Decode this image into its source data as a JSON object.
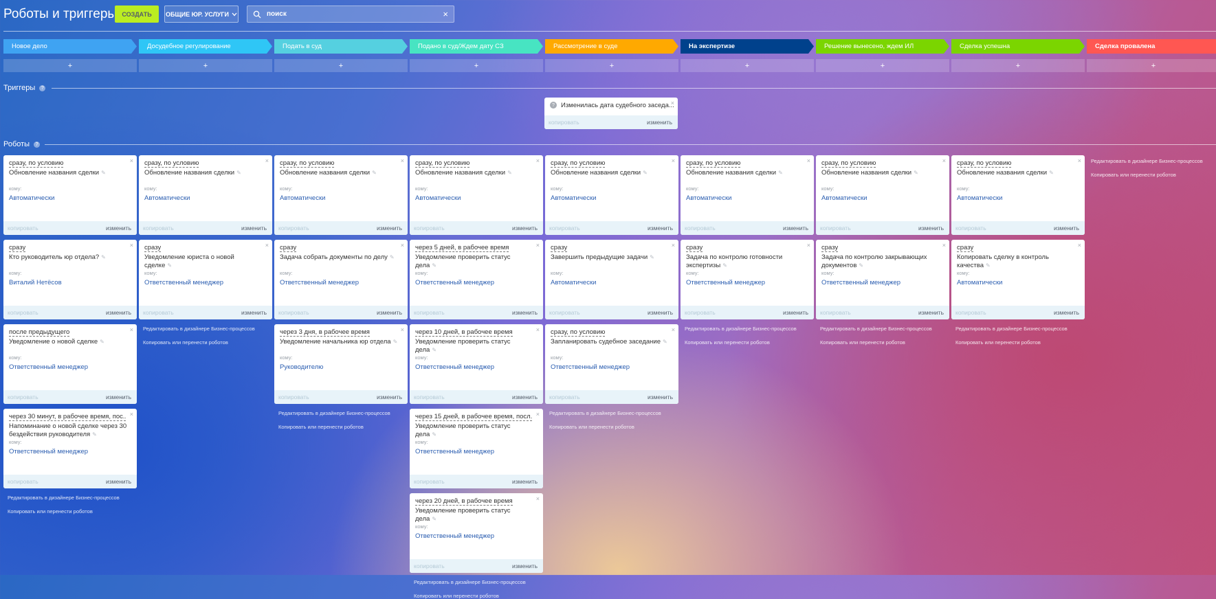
{
  "header": {
    "title": "Роботы и триггеры",
    "create_label": "СОЗДАТЬ",
    "category_label": "ОБЩИЕ ЮР. УСЛУГИ",
    "search_value": "поиск",
    "clear_symbol": "×"
  },
  "stages": [
    {
      "label": "Новое дело",
      "color": "#3fa3f2"
    },
    {
      "label": "Досудебное регулирование",
      "color": "#2fc6f6"
    },
    {
      "label": "Подать в суд",
      "color": "#55d0e0"
    },
    {
      "label": "Подано в суд/Ждем дату СЗ",
      "color": "#47e4c2"
    },
    {
      "label": "Рассмотрение в суде",
      "color": "#ffa900"
    },
    {
      "label": "На экспертизе",
      "color": "#00418c"
    },
    {
      "label": "Решение вынесено, ждем ИЛ",
      "color": "#7bd500"
    },
    {
      "label": "Сделка успешна",
      "color": "#7bd500"
    },
    {
      "label": "Сделка провалена",
      "color": "#ff5752"
    }
  ],
  "add_symbol": "+",
  "sections": {
    "triggers": "Триггеры",
    "robots": "Роботы",
    "help": "?"
  },
  "trigger": {
    "name": "Изменилась дата судебного заседа...",
    "copy": "копировать",
    "edit": "изменить"
  },
  "labels": {
    "to": "кому:",
    "copy": "копировать",
    "edit": "изменить",
    "close": "×",
    "pen": "✎",
    "bp_designer": "Редактировать в дизайнере Бизнес-процессов",
    "copy_move": "Копировать или перенести роботов"
  },
  "columns": [
    {
      "robots": [
        {
          "delay": "сразу, по условию",
          "title": "Обновление названия сделки",
          "to": "Автоматически"
        },
        {
          "delay": "сразу",
          "title": "Кто руководитель юр отдела?",
          "to": "Виталий Нетёсов"
        },
        {
          "delay": "после предыдущего",
          "title": "Уведомление о новой сделке",
          "to": "Ответственный менеджер"
        },
        {
          "delay": "через 30 минут, в рабочее время, пос...",
          "title": "Напоминание о новой сделке через 30 бездействия руководителя",
          "to": "Ответственный менеджер"
        }
      ]
    },
    {
      "robots": [
        {
          "delay": "сразу, по условию",
          "title": "Обновление названия сделки",
          "to": "Автоматически"
        },
        {
          "delay": "сразу",
          "title": "Уведомление юриста о новой сделке",
          "to": "Ответственный менеджер"
        }
      ]
    },
    {
      "robots": [
        {
          "delay": "сразу, по условию",
          "title": "Обновление названия сделки",
          "to": "Автоматически"
        },
        {
          "delay": "сразу",
          "title": "Задача собрать документы по делу",
          "to": "Ответственный менеджер"
        },
        {
          "delay": "через 3 дня, в рабочее время",
          "title": "Уведомление начальника юр отдела",
          "to": "Руководителю"
        }
      ]
    },
    {
      "robots": [
        {
          "delay": "сразу, по условию",
          "title": "Обновление названия сделки",
          "to": "Автоматически"
        },
        {
          "delay": "через 5 дней, в рабочее время",
          "title": "Уведомление проверить статус дела",
          "to": "Ответственный менеджер"
        },
        {
          "delay": "через 10 дней, в рабочее время",
          "title": "Уведомление проверить статус дела",
          "to": "Ответственный менеджер"
        },
        {
          "delay": "через 15 дней, в рабочее время, посл...",
          "title": "Уведомление проверить статус дела",
          "to": "Ответственный менеджер"
        },
        {
          "delay": "через 20 дней, в рабочее время",
          "title": "Уведомление проверить статус дела",
          "to": "Ответственный менеджер"
        }
      ]
    },
    {
      "robots": [
        {
          "delay": "сразу, по условию",
          "title": "Обновление названия сделки",
          "to": "Автоматически"
        },
        {
          "delay": "сразу",
          "title": "Завершить предыдущие задачи",
          "to": "Автоматически"
        },
        {
          "delay": "сразу, по условию",
          "title": "Запланировать судебное заседание",
          "to": "Ответственный менеджер"
        }
      ]
    },
    {
      "robots": [
        {
          "delay": "сразу, по условию",
          "title": "Обновление названия сделки",
          "to": "Автоматически"
        },
        {
          "delay": "сразу",
          "title": "Задача по контролю готовности экспертизы",
          "to": "Ответственный менеджер"
        }
      ]
    },
    {
      "robots": [
        {
          "delay": "сразу, по условию",
          "title": "Обновление названия сделки",
          "to": "Автоматически"
        },
        {
          "delay": "сразу",
          "title": "Задача по контролю закрывающих документов",
          "to": "Ответственный менеджер"
        }
      ]
    },
    {
      "robots": [
        {
          "delay": "сразу, по условию",
          "title": "Обновление названия сделки",
          "to": "Автоматически"
        },
        {
          "delay": "сразу",
          "title": "Копировать сделку в контроль качества",
          "to": "Автоматически"
        }
      ]
    },
    {
      "robots": []
    }
  ]
}
